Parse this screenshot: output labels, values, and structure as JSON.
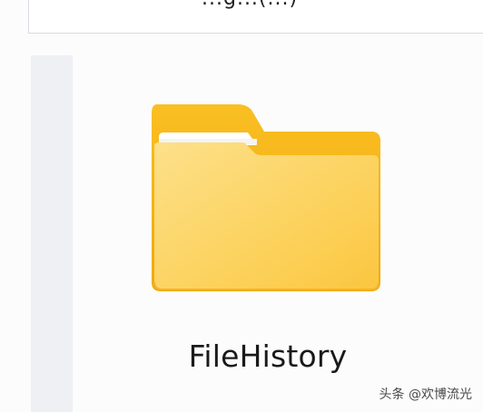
{
  "top_bar": {
    "partial_text": "...g...(...)"
  },
  "folder": {
    "name": "FileHistory",
    "icon": "folder-icon",
    "colors": {
      "back": "#f6b81c",
      "front": "#fcd66a",
      "paper": "#ffffff"
    }
  },
  "watermark": {
    "text": "头条 @欢博流光"
  }
}
